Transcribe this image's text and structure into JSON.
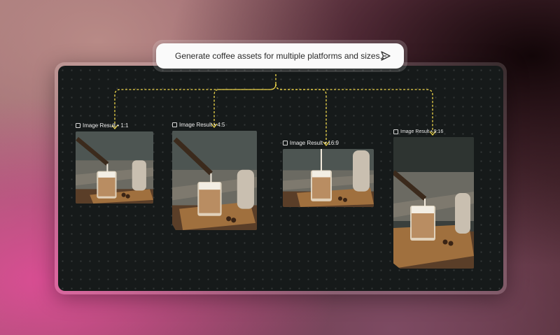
{
  "prompt": {
    "text": "Generate coffee assets for multiple platforms and sizes...",
    "send_icon": "send-icon"
  },
  "results": [
    {
      "label": "Image Result • 1:1",
      "icon": "image-icon"
    },
    {
      "label": "Image Result • 4:5",
      "icon": "image-icon"
    },
    {
      "label": "Image Result • 16:9",
      "icon": "image-icon"
    },
    {
      "label": "Image Result • 9:16",
      "icon": "image-icon"
    }
  ],
  "colors": {
    "connector": "#f1d84a",
    "canvas": "#161a1a",
    "accent_pink": "#d94e93"
  }
}
